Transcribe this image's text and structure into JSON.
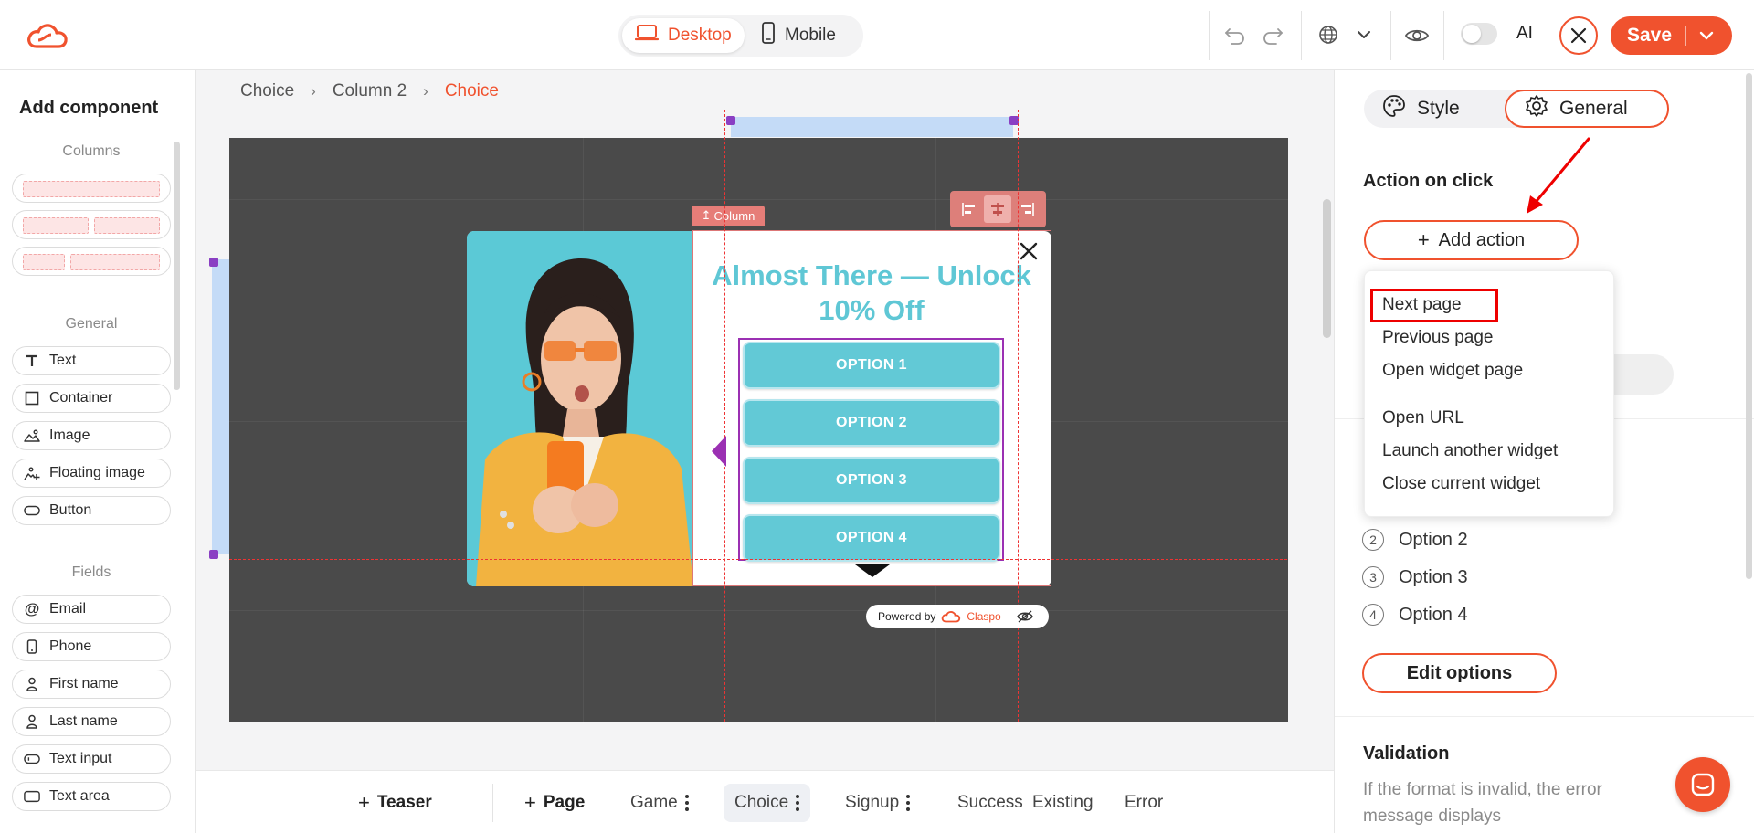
{
  "topbar": {
    "device_desktop": "Desktop",
    "device_mobile": "Mobile",
    "ai_label": "AI",
    "save_label": "Save"
  },
  "left_panel": {
    "title": "Add component",
    "sections": {
      "columns": "Columns",
      "general": "General",
      "fields": "Fields"
    },
    "general_items": [
      {
        "label": "Text",
        "icon": "text-icon"
      },
      {
        "label": "Container",
        "icon": "square-icon"
      },
      {
        "label": "Image",
        "icon": "image-icon"
      },
      {
        "label": "Floating image",
        "icon": "floating-image-icon"
      },
      {
        "label": "Button",
        "icon": "pill-icon"
      }
    ],
    "field_items": [
      {
        "label": "Email",
        "icon": "at-icon"
      },
      {
        "label": "Phone",
        "icon": "phone-icon"
      },
      {
        "label": "First name",
        "icon": "person-icon"
      },
      {
        "label": "Last name",
        "icon": "person-icon"
      },
      {
        "label": "Text input",
        "icon": "input-icon"
      },
      {
        "label": "Text area",
        "icon": "textarea-icon"
      }
    ]
  },
  "breadcrumb": [
    "Choice",
    "Column 2",
    "Choice"
  ],
  "popup": {
    "headline": "Almost There — Unlock 10% Off",
    "options": [
      "OPTION 1",
      "OPTION 2",
      "OPTION 3",
      "OPTION 4"
    ],
    "column_tag": "Column",
    "powered_by": "Powered by",
    "brand": "Claspo"
  },
  "pages": {
    "teaser": "Teaser",
    "page": "Page",
    "items": [
      "Game",
      "Choice",
      "Signup",
      "Success",
      "Existing",
      "Error"
    ]
  },
  "right_panel": {
    "tab_style": "Style",
    "tab_general": "General",
    "action_on_click": "Action on click",
    "add_action": "Add action",
    "dropdown_group1": [
      "Next page",
      "Previous page",
      "Open widget page"
    ],
    "dropdown_group2": [
      "Open URL",
      "Launch another widget",
      "Close current widget"
    ],
    "options": [
      {
        "num": "2",
        "label": "Option 2"
      },
      {
        "num": "3",
        "label": "Option 3"
      },
      {
        "num": "4",
        "label": "Option 4"
      }
    ],
    "edit_options": "Edit options",
    "validation_title": "Validation",
    "validation_text": "If the format is invalid, the error message displays"
  },
  "colors": {
    "accent": "#f0522e",
    "popup_teal": "#5fc7d5",
    "selection_purple": "#9b30b3",
    "canvas_dark": "#4a4a4a"
  }
}
